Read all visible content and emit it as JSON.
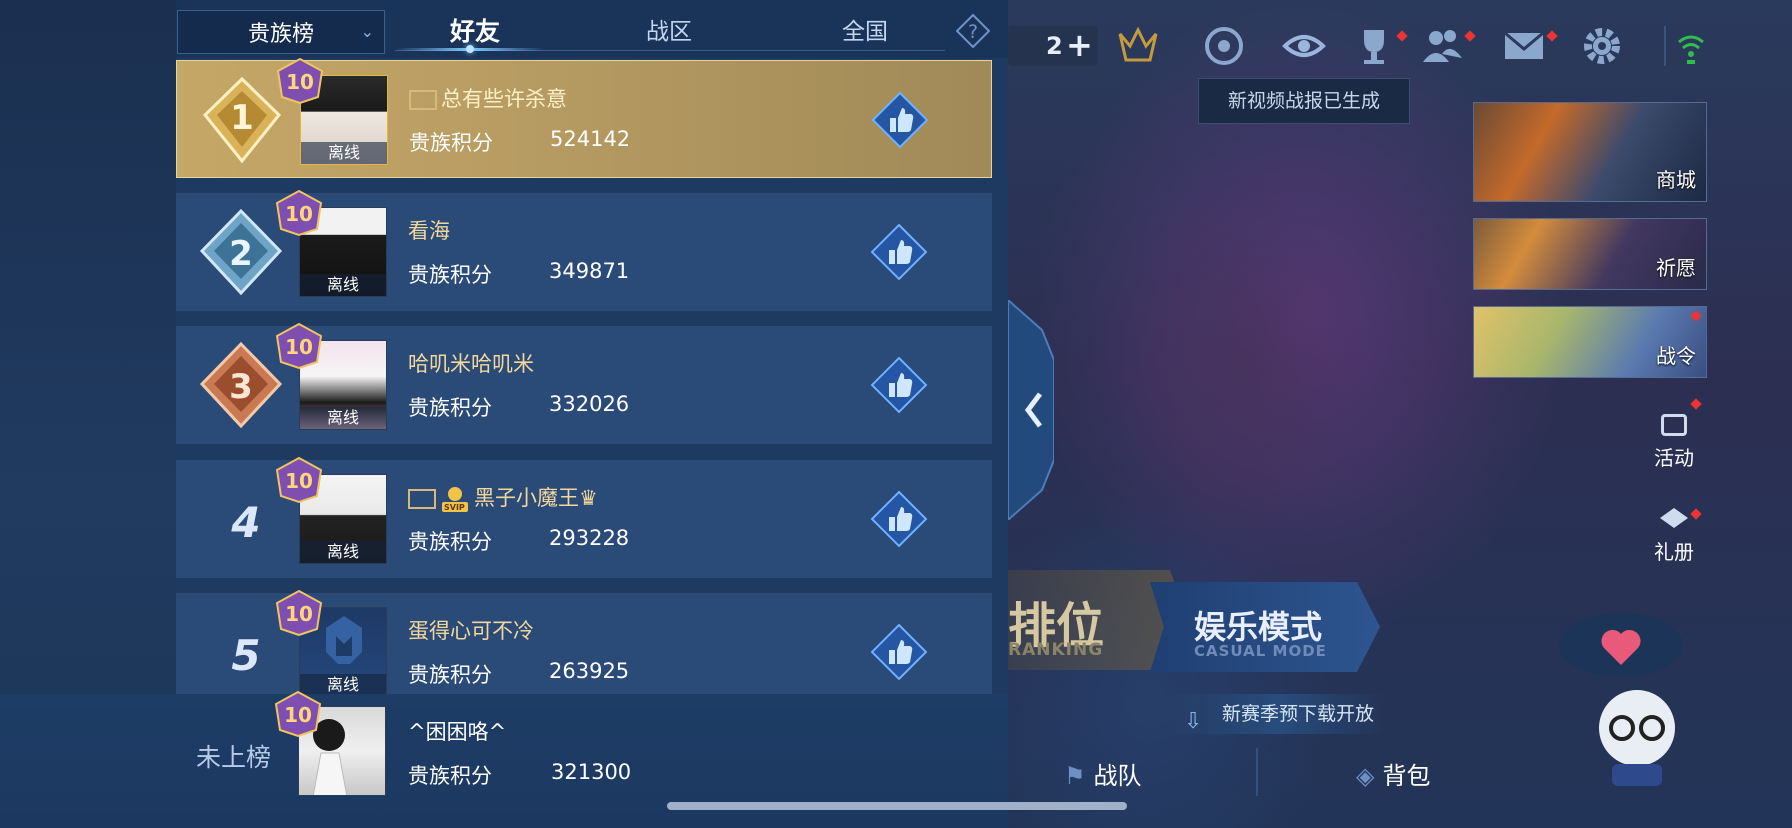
{
  "leaderboard": {
    "category": "贵族榜",
    "tabs": {
      "friends": "好友",
      "zone": "战区",
      "nation": "全国"
    },
    "level_badge": "10",
    "score_label": "贵族积分",
    "offline_label": "离线",
    "rows": [
      {
        "rank": "1",
        "name": "总有些许杀意",
        "score": "524142",
        "offline": true
      },
      {
        "rank": "2",
        "name": "看海",
        "score": "349871",
        "offline": true
      },
      {
        "rank": "3",
        "name": "哈叽米哈叽米",
        "score": "332026",
        "offline": true
      },
      {
        "rank": "4",
        "name": "黑子小魔王♛",
        "score": "293228",
        "offline": true,
        "svip": "SVIP"
      },
      {
        "rank": "5",
        "name": "蛋得心可不冷",
        "score": "263925",
        "offline": true
      }
    ],
    "self": {
      "rank_label": "未上榜",
      "name": "^困困咯^",
      "score": "321300"
    }
  },
  "hud": {
    "friend_count": "2",
    "tooltip": "新视频战报已生成",
    "side_cards": {
      "shop": "商城",
      "wish": "祈愿",
      "battle_pass": "战令"
    },
    "side_links": {
      "activity": "活动",
      "gift_book": "礼册"
    },
    "modes": {
      "ranked_cn": "排位",
      "ranked_en": "RANKING",
      "casual_cn": "娱乐模式",
      "casual_en": "CASUAL MODE"
    },
    "new_season": "新赛季预下载开放",
    "bottom": {
      "team": "战队",
      "bag": "背包"
    }
  },
  "colors": {
    "gold_row": "#c5a767",
    "row_bg": "#2a4a78",
    "name_gold": "#f3d89b"
  }
}
